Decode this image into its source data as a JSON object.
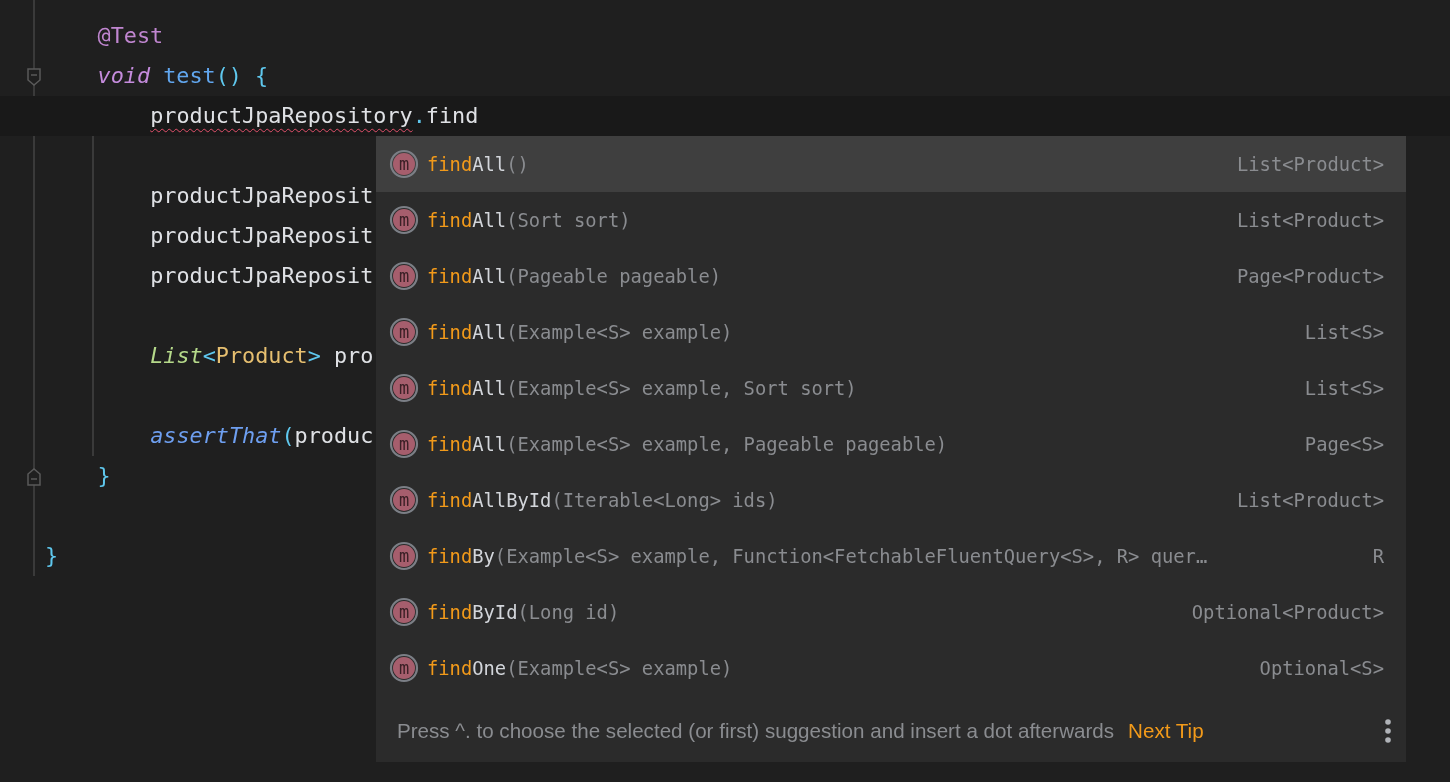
{
  "editor": {
    "lines": [
      {
        "tokens": [
          {
            "text": "@Test",
            "kind": "annotation"
          }
        ]
      },
      {
        "fold_start": true,
        "tokens": [
          {
            "text": "void",
            "kind": "keyword"
          },
          {
            "text": " test",
            "kind": "method"
          },
          {
            "text": "() {",
            "kind": "brace"
          }
        ],
        "children": [
          {
            "current": true,
            "tokens": [
              {
                "text": "productJpaRepository",
                "kind": "plain",
                "error": true
              },
              {
                "text": ".",
                "kind": "brace"
              },
              {
                "text": "find",
                "kind": "plain"
              }
            ]
          },
          {
            "gap_before": true,
            "tokens": [
              {
                "text": "productJpaReposit",
                "kind": "plain"
              }
            ]
          },
          {
            "tokens": [
              {
                "text": "productJpaReposit",
                "kind": "plain"
              }
            ]
          },
          {
            "tokens": [
              {
                "text": "productJpaReposit",
                "kind": "plain"
              }
            ]
          },
          {
            "gap_before": true,
            "tokens": [
              {
                "text": "List",
                "kind": "interface"
              },
              {
                "text": "<",
                "kind": "brace"
              },
              {
                "text": "Product",
                "kind": "class"
              },
              {
                "text": ">",
                "kind": "brace"
              },
              {
                "text": " pro",
                "kind": "plain"
              }
            ]
          },
          {
            "gap_before": true,
            "tokens": [
              {
                "text": "assertThat",
                "kind": "static"
              },
              {
                "text": "(",
                "kind": "brace"
              },
              {
                "text": "produc",
                "kind": "plain"
              }
            ]
          }
        ]
      },
      {
        "fold_end": true,
        "tokens": [
          {
            "text": "}",
            "kind": "brace"
          }
        ]
      }
    ],
    "closing_lines": [
      {
        "gap_before": true,
        "tokens": [
          {
            "text": "}",
            "kind": "brace"
          }
        ]
      }
    ]
  },
  "completion": {
    "items": [
      {
        "icon": "m",
        "match": "find",
        "name": "All",
        "params": "()",
        "type": "List<Product>",
        "selected": true
      },
      {
        "icon": "m",
        "match": "find",
        "name": "All",
        "params": "(Sort sort)",
        "type": "List<Product>",
        "selected": false
      },
      {
        "icon": "m",
        "match": "find",
        "name": "All",
        "params": "(Pageable pageable)",
        "type": "Page<Product>",
        "selected": false
      },
      {
        "icon": "m",
        "match": "find",
        "name": "All",
        "params": "(Example<S> example)",
        "type": "List<S>",
        "selected": false
      },
      {
        "icon": "m",
        "match": "find",
        "name": "All",
        "params": "(Example<S> example, Sort sort)",
        "type": "List<S>",
        "selected": false
      },
      {
        "icon": "m",
        "match": "find",
        "name": "All",
        "params": "(Example<S> example, Pageable pageable)",
        "type": "Page<S>",
        "selected": false
      },
      {
        "icon": "m",
        "match": "find",
        "name": "AllById",
        "params": "(Iterable<Long> ids)",
        "type": "List<Product>",
        "selected": false
      },
      {
        "icon": "m",
        "match": "find",
        "name": "By",
        "params": "(Example<S> example, Function<FetchableFluentQuery<S>, R> quer…",
        "type": "R",
        "selected": false
      },
      {
        "icon": "m",
        "match": "find",
        "name": "ById",
        "params": "(Long id)",
        "type": "Optional<Product>",
        "selected": false
      },
      {
        "icon": "m",
        "match": "find",
        "name": "One",
        "params": "(Example<S> example)",
        "type": "Optional<S>",
        "selected": false
      }
    ],
    "hint": "Press ^. to choose the selected (or first) suggestion and insert a dot afterwards",
    "next_tip": "Next Tip"
  }
}
